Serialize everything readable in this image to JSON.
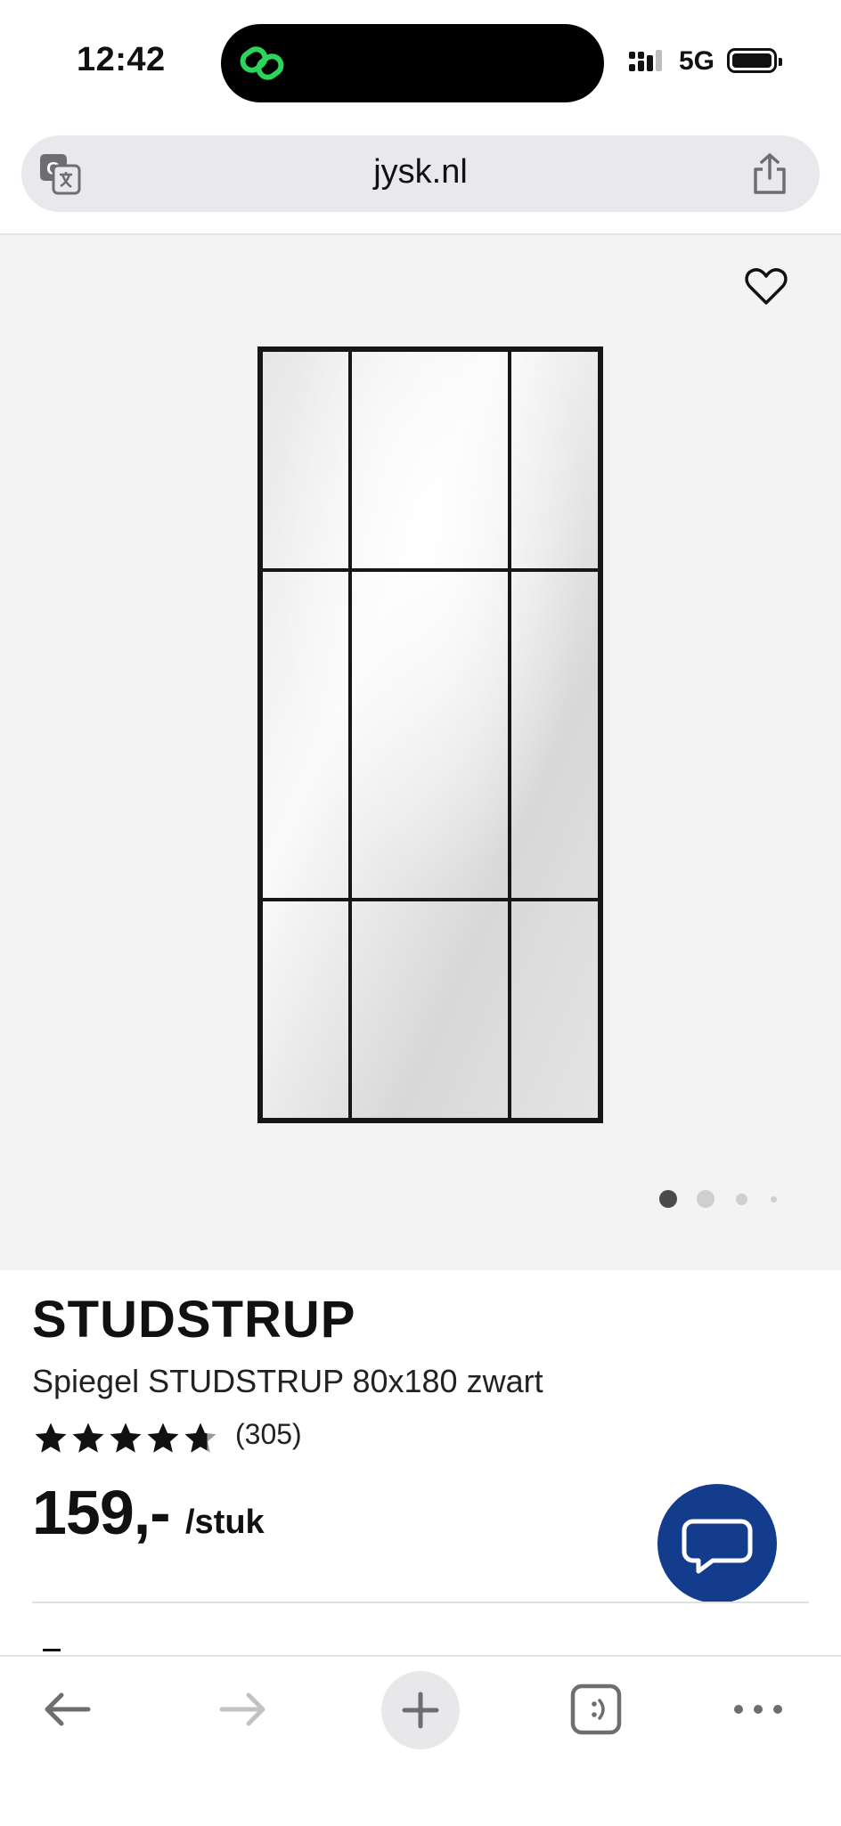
{
  "status": {
    "time": "12:42",
    "network": "5G"
  },
  "browser": {
    "url": "jysk.nl"
  },
  "gallery": {
    "image_alt": "Spiegel STUDSTRUP 80x180 zwart",
    "active_slide": 1,
    "slide_count": 4
  },
  "product": {
    "brand": "STUDSTRUP",
    "name": "Spiegel STUDSTRUP 80x180 zwart",
    "rating": 4.5,
    "rating_max": 5,
    "review_count": "(305)",
    "price": "159,-",
    "price_unit": "/stuk"
  },
  "colors": {
    "accent_chat": "#143c8c",
    "gallery_bg": "#f3f3f3",
    "status_icon": "#2bd45a"
  },
  "icons": {
    "translate": "translate-icon",
    "share": "share-icon",
    "favorite": "heart-icon",
    "chat": "chat-bubble-icon",
    "back": "arrow-left-icon",
    "forward": "arrow-right-icon",
    "new_tab": "plus-icon",
    "tabs": "tabs-icon",
    "more": "more-icon"
  }
}
